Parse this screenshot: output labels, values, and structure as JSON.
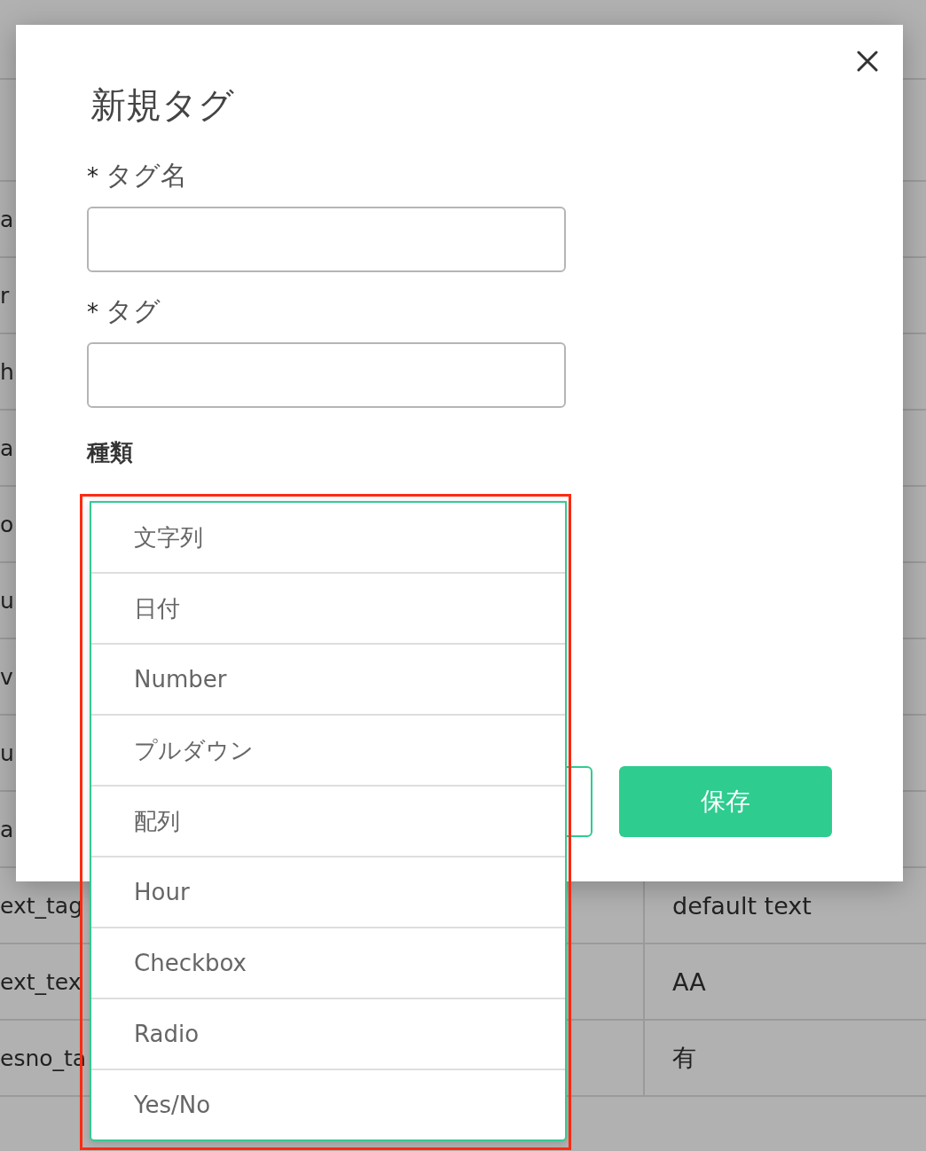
{
  "background_table": {
    "rows": [
      {
        "column_1": "a"
      },
      {
        "column_1": "r"
      },
      {
        "column_1": "h"
      },
      {
        "column_1": "a"
      },
      {
        "column_1": "o"
      },
      {
        "column_1": "u"
      },
      {
        "column_1": "v"
      },
      {
        "column_1": "u"
      },
      {
        "column_1": "a"
      },
      {
        "column_1": "ext_tag",
        "column_2": "default text"
      },
      {
        "column_1": "ext_tex",
        "column_2": "AA"
      },
      {
        "column_1": "esno_ta",
        "column_2": "有"
      }
    ]
  },
  "dialog": {
    "title": "新規タグ",
    "fields": [
      {
        "required_mark": "*",
        "label": "タグ名"
      },
      {
        "required_mark": "*",
        "label": "タグ"
      }
    ],
    "type_label": "種類",
    "type_dropdown": {
      "highlighted": true,
      "options": [
        {
          "label": "文字列",
          "selected": false
        },
        {
          "label": "日付",
          "selected": false
        },
        {
          "label": "Number",
          "selected": false
        },
        {
          "label": "プルダウン",
          "selected": false
        },
        {
          "label": "配列",
          "selected": false
        },
        {
          "label": "Hour",
          "selected": false
        },
        {
          "label": "Checkbox",
          "selected": false
        },
        {
          "label": "Radio",
          "selected": false
        },
        {
          "label": "Yes/No",
          "selected": false
        }
      ]
    },
    "buttons": [
      {
        "kind": "outline"
      },
      {
        "kind": "primary",
        "label": "保存"
      }
    ]
  }
}
